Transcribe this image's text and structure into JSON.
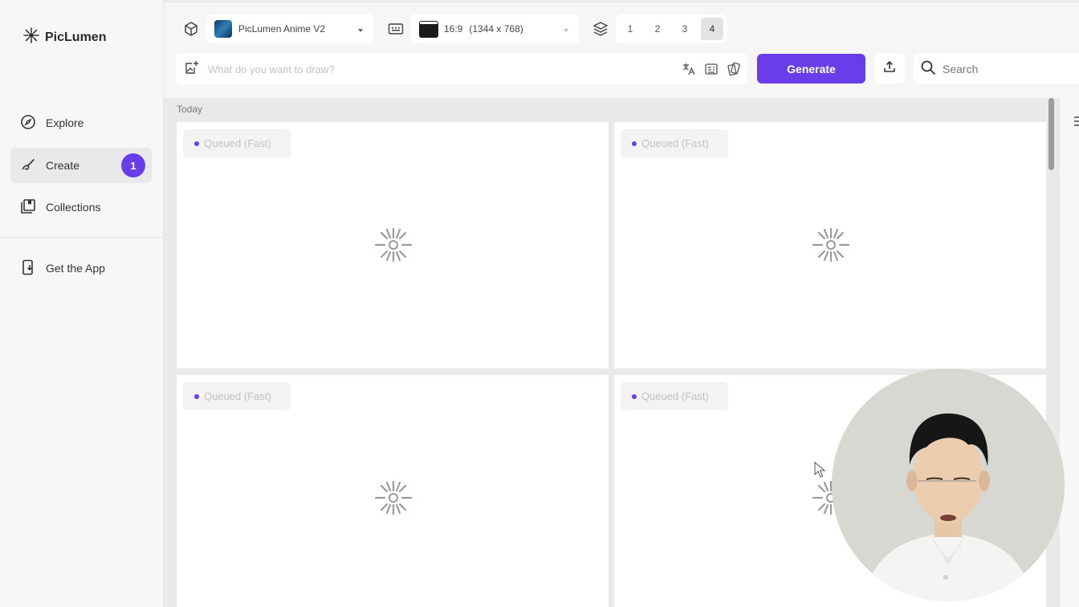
{
  "app": {
    "name": "PicLumen"
  },
  "sidebar": {
    "items": [
      {
        "label": "Explore",
        "icon": "compass-icon"
      },
      {
        "label": "Create",
        "icon": "brush-icon",
        "badge": "1"
      },
      {
        "label": "Collections",
        "icon": "collections-icon"
      },
      {
        "label": "Get the App",
        "icon": "download-app-icon"
      }
    ]
  },
  "toolbar": {
    "model": {
      "label": "PicLumen Anime V2"
    },
    "aspect": {
      "ratio": "16:9",
      "size": "(1344 x 768)"
    },
    "counts": [
      "1",
      "2",
      "3",
      "4"
    ],
    "selected_count": "4"
  },
  "prompt": {
    "placeholder": "What do you want to draw?"
  },
  "actions": {
    "generate_label": "Generate"
  },
  "search": {
    "placeholder": "Search"
  },
  "gallery": {
    "section_label": "Today",
    "cards": [
      {
        "status": "Queued (Fast)"
      },
      {
        "status": "Queued (Fast)"
      },
      {
        "status": "Queued (Fast)"
      },
      {
        "status": "Queued (Fast)"
      }
    ]
  },
  "colors": {
    "accent": "#6a3de8"
  }
}
